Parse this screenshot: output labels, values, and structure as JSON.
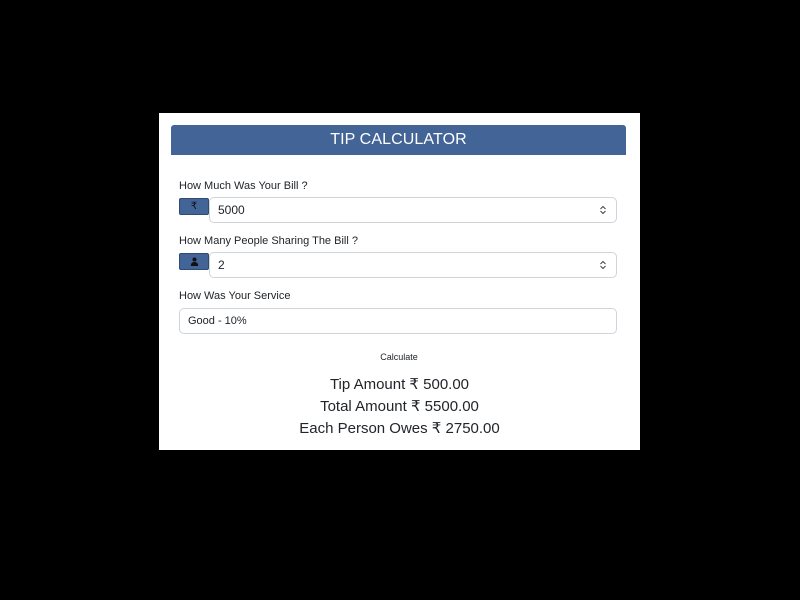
{
  "app": {
    "title": "TIP CALCULATOR"
  },
  "bill": {
    "label": "How Much Was Your Bill ?",
    "currency_symbol": "₹",
    "value": "5000"
  },
  "people": {
    "label": "How Many People Sharing The Bill ?",
    "icon": "person-icon",
    "value": "2"
  },
  "service": {
    "label": "How Was Your Service",
    "selected": "Good - 10%"
  },
  "actions": {
    "calculate_label": "Calculate"
  },
  "results": {
    "tip": "Tip Amount ₹ 500.00",
    "total": "Total Amount ₹ 5500.00",
    "each": "Each Person Owes ₹ 2750.00"
  },
  "colors": {
    "accent": "#436496",
    "background": "#000000",
    "card": "#ffffff"
  }
}
